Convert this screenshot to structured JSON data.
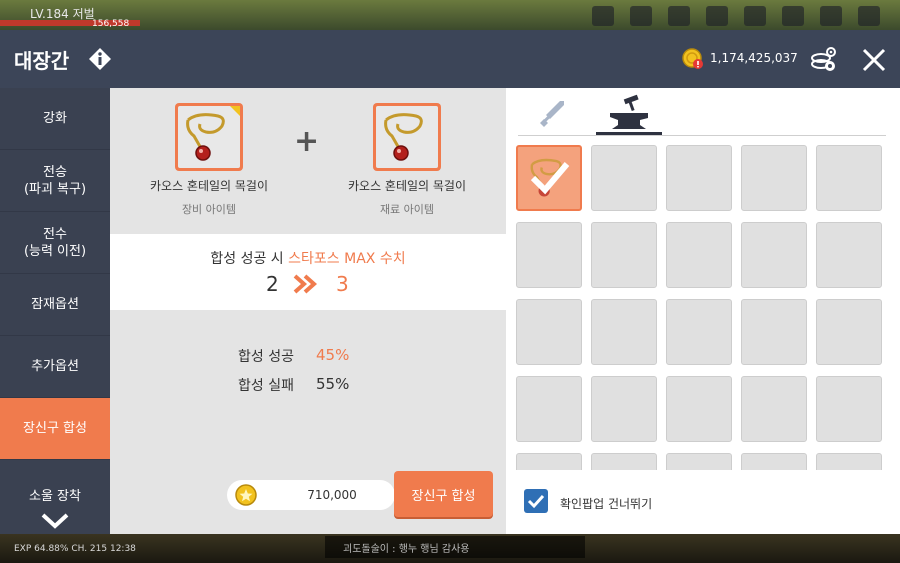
{
  "game_hud": {
    "level": "LV.184 저벌",
    "hp_text": "156,558",
    "exp_text": "EXP  64.88%  CH. 215  12:38",
    "chat_text": "괴도돌술이 : 행누 행님 감사용"
  },
  "header": {
    "title": "대장간",
    "meso": "1,174,425,037"
  },
  "sidebar": {
    "items": [
      {
        "label": "강화"
      },
      {
        "label": "전승\n(파괴 복구)"
      },
      {
        "label": "전수\n(능력 이전)"
      },
      {
        "label": "잠재옵션"
      },
      {
        "label": "추가옵션"
      },
      {
        "label": "장신구 합성"
      },
      {
        "label": "소울 장착"
      }
    ],
    "active_index": 5
  },
  "synthesis": {
    "item_a_name": "카오스 혼테일의 목걸이",
    "item_a_sub": "장비 아이템",
    "item_b_name": "카오스 혼테일의 목걸이",
    "item_b_sub": "재료 아이템",
    "plus_symbol": "+",
    "star_prefix": "합성 성공 시 ",
    "star_highlight": "스타포스 MAX 수치",
    "star_from": "2",
    "star_to": "3",
    "success_label": "합성 성공",
    "success_value": "45%",
    "fail_label": "합성 실패",
    "fail_value": "55%",
    "cost": "710,000",
    "button_label": "장신구 합성"
  },
  "inventory": {
    "tabs": [
      {
        "icon": "sword-icon"
      },
      {
        "icon": "anvil-icon"
      }
    ],
    "active_tab": 1,
    "selected_cell": 0,
    "skip_popup_checked": true,
    "skip_popup_label": "확인팝업 건너뛰기"
  },
  "colors": {
    "accent": "#f07b4d",
    "header_bg": "#3c4558",
    "sidebar_bg": "#3a4151",
    "checkbox": "#2f6fb5"
  }
}
